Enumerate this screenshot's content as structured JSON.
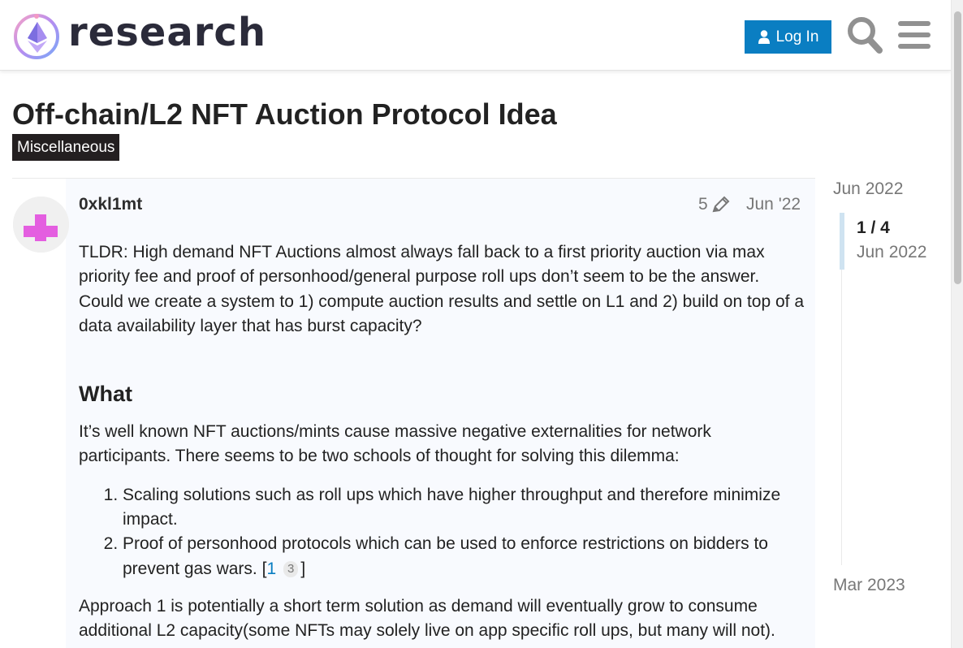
{
  "header": {
    "logo_text": "research",
    "login_label": "Log In",
    "icons": [
      "user-icon",
      "search-icon",
      "menu-icon"
    ]
  },
  "topic": {
    "title": "Off-chain/L2 NFT Auction Protocol Idea",
    "category": "Miscellaneous"
  },
  "post": {
    "username": "0xkl1mt",
    "edit_count": "5",
    "date": "Jun '22",
    "tldr": "TLDR: High demand NFT Auctions almost always fall back to a first priority auction via max priority fee and proof of personhood/general purpose roll ups don’t seem to be the answer. Could we create a system to 1) compute auction results and settle on L1 and 2) build on top of a data availability layer that has burst capacity?",
    "heading_what": "What",
    "intro": "It’s well known NFT auctions/mints cause massive negative externalities for network participants. There seems to be two schools of thought for solving this dilemma:",
    "list": [
      "Scaling solutions such as roll ups which have higher throughput and therefore minimize impact.",
      "Proof of personhood protocols which can be used to enforce restrictions on bidders to prevent gas wars."
    ],
    "footnote_open": "[",
    "footnote_link": "1",
    "footnote_badge": "3",
    "footnote_close": "]",
    "approach": "Approach 1 is potentially a short term solution as demand will eventually grow to consume additional L2 capacity(some NFTs may solely live on app specific roll ups, but many will not)."
  },
  "timeline": {
    "start": "Jun 2022",
    "position": "1 / 4",
    "current_date": "Jun 2022",
    "end": "Mar 2023"
  },
  "colors": {
    "accent": "#0a7ec2",
    "category_bg": "#231f20",
    "avatar": "#e45ee0"
  }
}
